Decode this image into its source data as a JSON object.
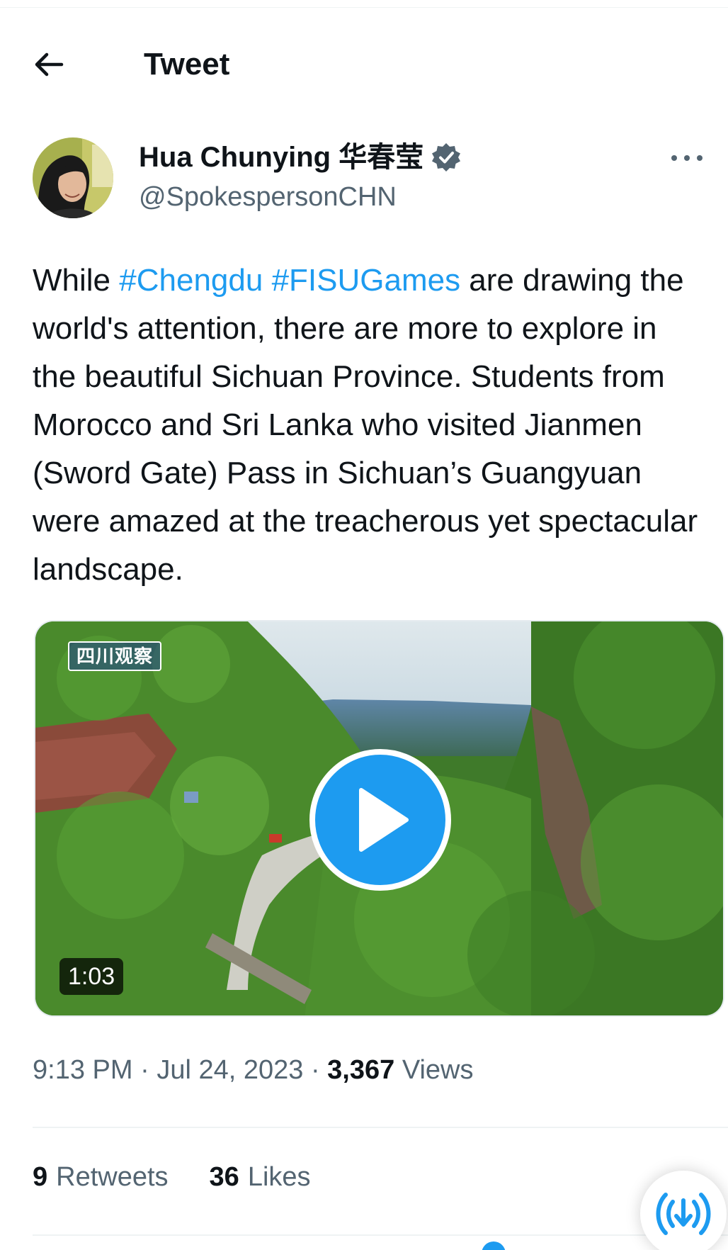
{
  "header": {
    "back_icon": "arrow-left-icon",
    "title": "Tweet"
  },
  "author": {
    "name": "Hua Chunying 华春莹",
    "handle": "@SpokespersonCHN",
    "verified_icon": "verified-badge-icon",
    "verified_color": "#536471",
    "more_icon": "more-horizontal-icon"
  },
  "tweet": {
    "segments": [
      {
        "text": "While ",
        "hashtag": false
      },
      {
        "text": "#Chengdu",
        "hashtag": true
      },
      {
        "text": " ",
        "hashtag": false
      },
      {
        "text": "#FISUGames",
        "hashtag": true
      },
      {
        "text": " are drawing the world's attention, there are more to explore in the beautiful Sichuan Province. Students from Morocco and Sri Lanka who visited Jianmen (Sword Gate) Pass in Sichuan’s Guangyuan were amazed at the treacherous yet spectacular landscape.",
        "hashtag": false
      }
    ],
    "link_color": "#1d9bf0"
  },
  "media": {
    "type": "video",
    "watermark": "四川观察",
    "duration": "1:03",
    "play_icon": "play-icon"
  },
  "meta": {
    "time": "9:13 PM",
    "separator": "·",
    "date": "Jul 24, 2023",
    "views_count": "3,367",
    "views_label": "Views"
  },
  "stats": {
    "retweets_count": "9",
    "retweets_label": "Retweets",
    "likes_count": "36",
    "likes_label": "Likes"
  },
  "fab": {
    "icon": "spaces-icon"
  },
  "colors": {
    "accent": "#1d9bf0",
    "text_primary": "#0f1419",
    "text_secondary": "#536471"
  }
}
